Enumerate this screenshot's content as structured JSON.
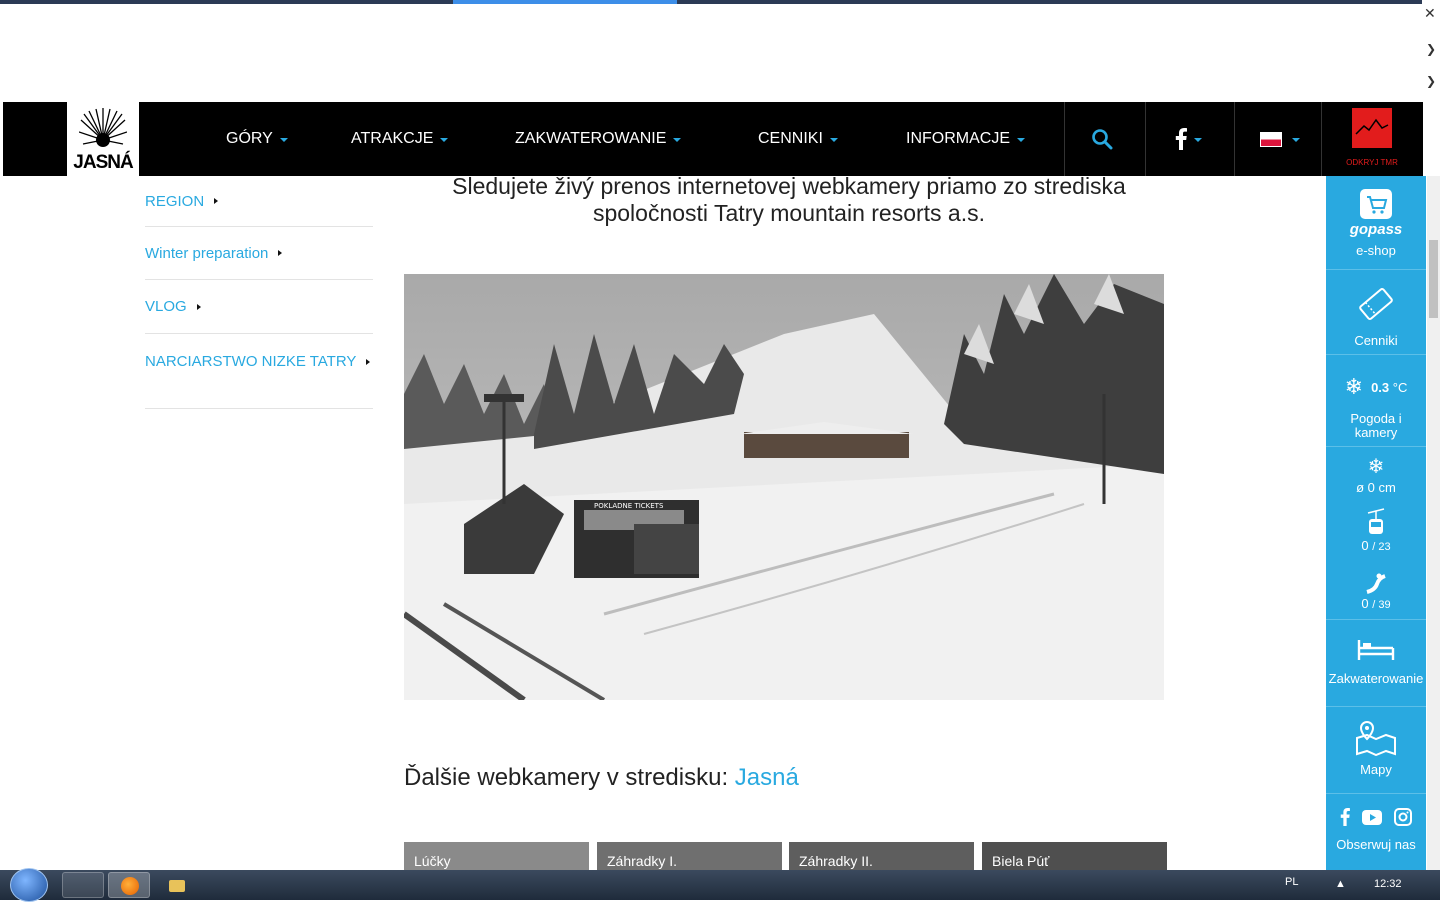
{
  "nav": {
    "logo": "JASNÁ",
    "items": [
      {
        "label": "GÓRY"
      },
      {
        "label": "ATRAKCJE"
      },
      {
        "label": "ZAKWATEROWANIE"
      },
      {
        "label": "CENNIKI"
      },
      {
        "label": "INFORMACJE"
      }
    ],
    "tmr_label": "ODKRYJ TMR"
  },
  "side_menu": {
    "items": [
      {
        "label": "REGION"
      },
      {
        "label": "Winter preparation"
      },
      {
        "label": "VLOG"
      },
      {
        "label": "NARCIARSTWO NIZKE TATRY"
      }
    ]
  },
  "main": {
    "heading": "Sledujete živý prenos internetovej webkamery priamo zo strediska spoločnosti Tatry mountain resorts a.s.",
    "other_heading_prefix": "Ďalšie webkamery v stredisku: ",
    "other_heading_link": "Jasná",
    "webcam_signs": {
      "tickets": "POKLADNE TICKETS"
    },
    "thumbnails": [
      {
        "label": "Lúčky"
      },
      {
        "label": "Záhradky I."
      },
      {
        "label": "Záhradky II."
      },
      {
        "label": "Biela Púť"
      }
    ]
  },
  "right_sidebar": {
    "gopass": "gopass",
    "eshop": "e-shop",
    "cenniki": "Cenniki",
    "temp_value": "0.3",
    "temp_unit": "°C",
    "pogoda": "Pogoda i kamery",
    "snow": "ø 0 cm",
    "lifts": "0",
    "lifts_total": "/ 23",
    "slopes": "0",
    "slopes_total": "/ 39",
    "zakwaterowanie": "Zakwaterowanie",
    "mapy": "Mapy",
    "obserwuj": "Obserwuj nas"
  },
  "taskbar": {
    "lang": "PL",
    "time": "12:32"
  },
  "colors": {
    "accent": "#29a9e0",
    "nav_bg": "#000000",
    "tmr_red": "#e21c1c"
  }
}
